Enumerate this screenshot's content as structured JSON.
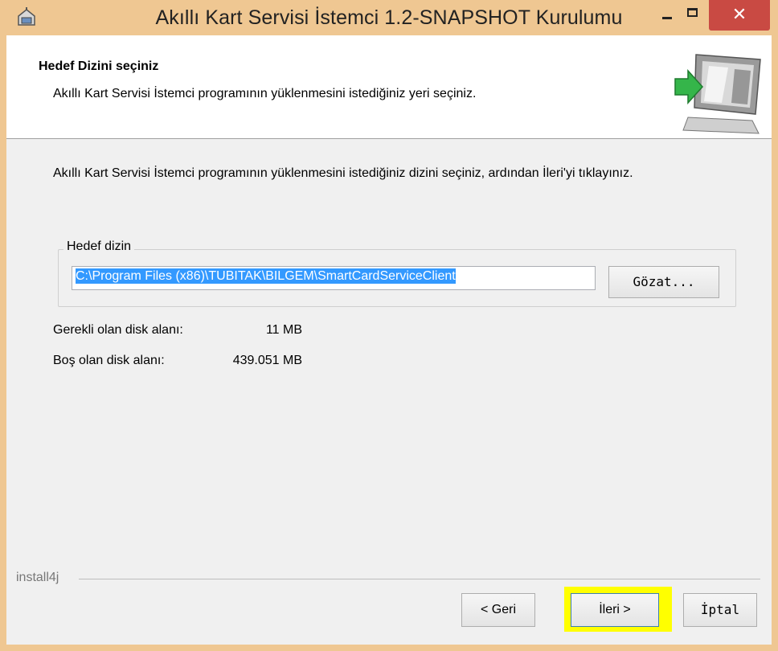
{
  "window": {
    "title": "Akıllı Kart Servisi İstemci 1.2-SNAPSHOT Kurulumu",
    "close_glyph": "✕"
  },
  "header": {
    "title": "Hedef Dizini seçiniz",
    "subtitle": "Akıllı Kart Servisi İstemci programının yüklenmesini istediğiniz yeri seçiniz.",
    "image_icon": "computer-install-icon"
  },
  "main": {
    "instruction": "Akıllı Kart Servisi İstemci programının yüklenmesini istediğiniz dizini seçiniz, ardından İleri'yi tıklayınız.",
    "destination_group": {
      "label": "Hedef dizin",
      "path_value": "C:\\Program Files (x86)\\TUBITAK\\BILGEM\\SmartCardServiceClient",
      "browse_label": "Gözat..."
    },
    "disk": {
      "required_label": "Gerekli olan disk alanı:",
      "required_value": "11 MB",
      "free_label": "Boş olan disk alanı:",
      "free_value": "439.051 MB"
    }
  },
  "footer": {
    "vendor": "install4j",
    "back_label": "< Geri",
    "next_label": "İleri >",
    "cancel_label": "İptal"
  },
  "colors": {
    "titlebar": "#efc792",
    "close_button": "#c94a43",
    "selection": "#3399ff",
    "highlight": "#ffff00"
  }
}
